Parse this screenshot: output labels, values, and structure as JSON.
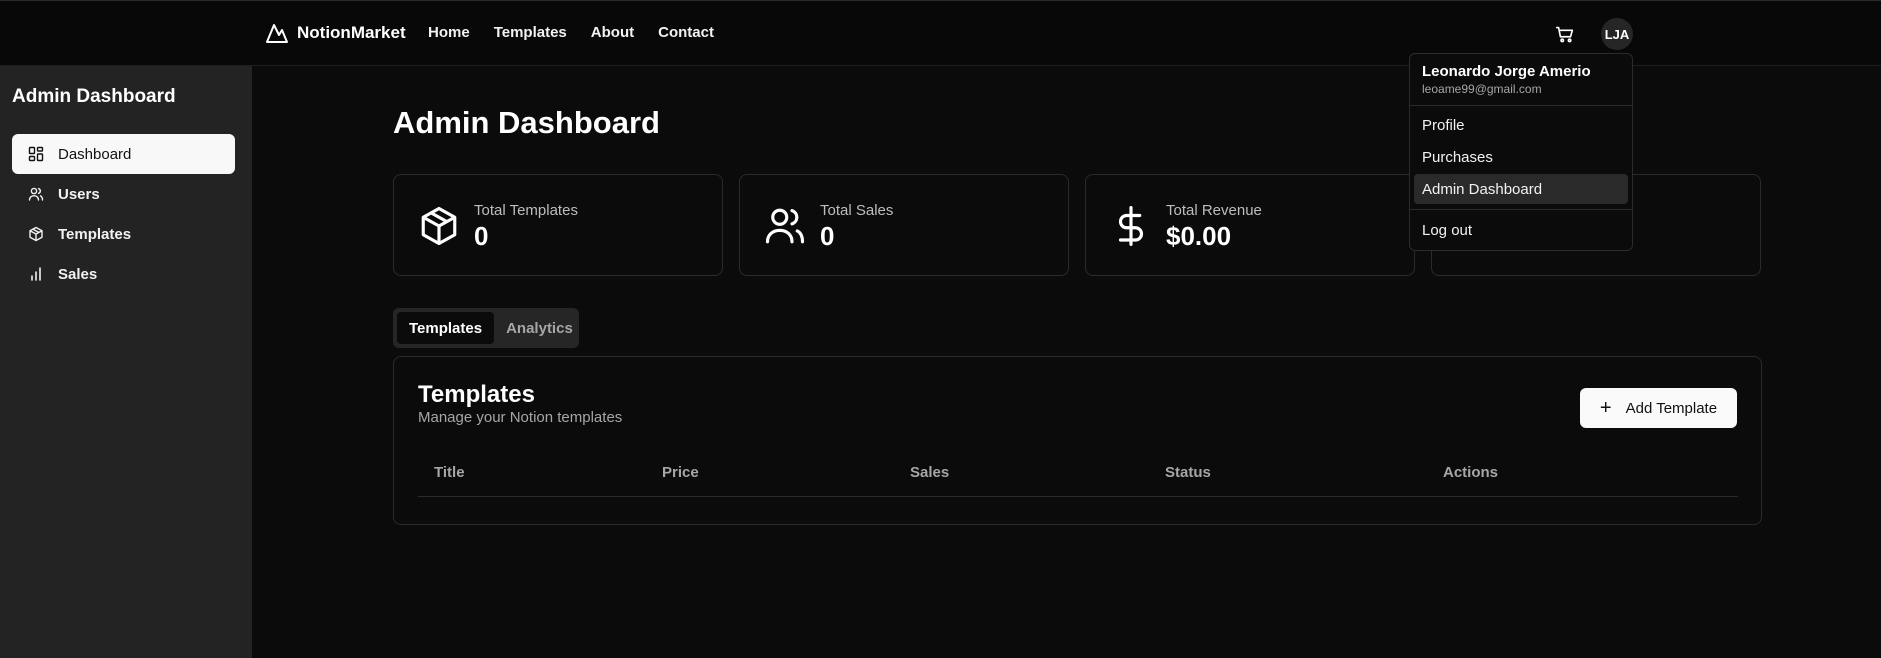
{
  "brand": {
    "name": "NotionMarket"
  },
  "nav": {
    "items": [
      "Home",
      "Templates",
      "About",
      "Contact"
    ]
  },
  "user": {
    "initials": "LJA",
    "name": "Leonardo Jorge Amerio",
    "email": "leoame99@gmail.com"
  },
  "user_menu": {
    "items": [
      "Profile",
      "Purchases",
      "Admin Dashboard"
    ],
    "active": "Admin Dashboard",
    "logout": "Log out"
  },
  "sidebar": {
    "title": "Admin Dashboard",
    "items": [
      {
        "label": "Dashboard",
        "icon": "grid-icon",
        "active": true
      },
      {
        "label": "Users",
        "icon": "users-icon",
        "active": false
      },
      {
        "label": "Templates",
        "icon": "package-icon",
        "active": false
      },
      {
        "label": "Sales",
        "icon": "bar-chart-icon",
        "active": false
      }
    ]
  },
  "main": {
    "title": "Admin Dashboard",
    "stats": [
      {
        "label": "Total Templates",
        "value": "0",
        "icon": "package-icon"
      },
      {
        "label": "Total Sales",
        "value": "0",
        "icon": "users-icon"
      },
      {
        "label": "Total Revenue",
        "value": "$0.00",
        "icon": "dollar-icon"
      }
    ],
    "tabs": [
      {
        "label": "Templates",
        "active": true
      },
      {
        "label": "Analytics",
        "active": false
      }
    ],
    "card": {
      "title": "Templates",
      "subtitle": "Manage your Notion templates",
      "add_button": "Add Template",
      "columns": [
        "Title",
        "Price",
        "Sales",
        "Status",
        "Actions"
      ]
    }
  },
  "colors": {
    "background": "#0b0b0b",
    "sidebar": "#232323",
    "accent": "#fafafa",
    "muted": "#a6a6a6"
  }
}
